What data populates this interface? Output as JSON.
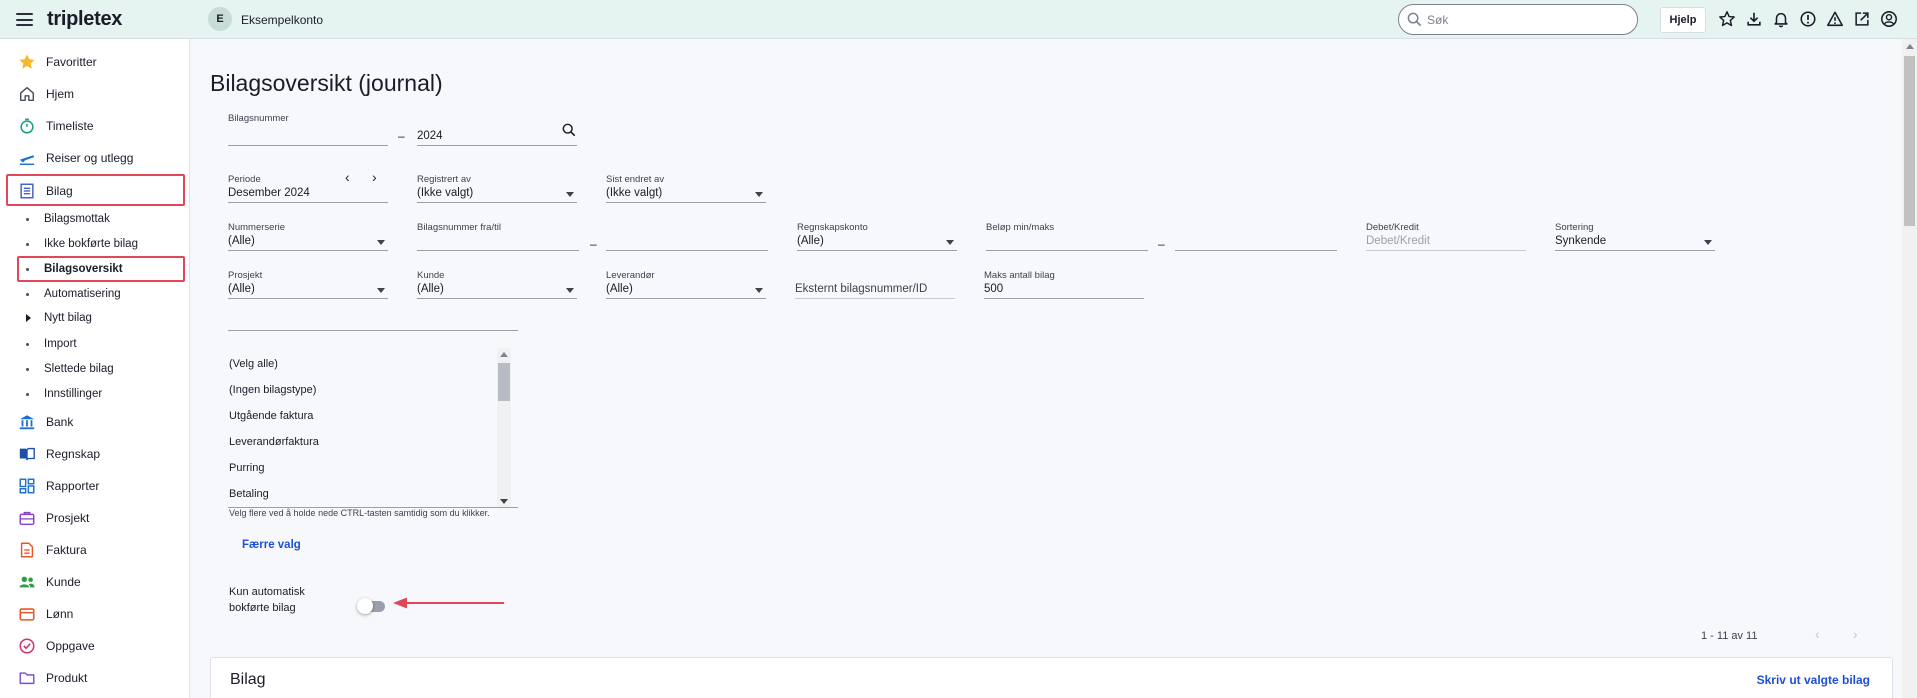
{
  "topbar": {
    "logo": "tripletex",
    "account_initial": "E",
    "account_name": "Eksempelkonto",
    "search_placeholder": "Søk",
    "help_label": "Hjelp",
    "icons": [
      "star-icon",
      "download-icon",
      "bell-icon",
      "alert-circle-icon",
      "warning-icon",
      "external-link-icon",
      "user-icon"
    ]
  },
  "sidebar": {
    "items": [
      {
        "label": "Favoritter",
        "icon": "star-icon"
      },
      {
        "label": "Hjem",
        "icon": "home-icon"
      },
      {
        "label": "Timeliste",
        "icon": "stopwatch-icon"
      },
      {
        "label": "Reiser og utlegg",
        "icon": "plane-icon"
      },
      {
        "label": "Bilag",
        "icon": "document-icon"
      },
      {
        "label": "Bank",
        "icon": "bank-icon"
      },
      {
        "label": "Regnskap",
        "icon": "book-icon"
      },
      {
        "label": "Rapporter",
        "icon": "dashboard-icon"
      },
      {
        "label": "Prosjekt",
        "icon": "briefcase-icon"
      },
      {
        "label": "Faktura",
        "icon": "invoice-icon"
      },
      {
        "label": "Kunde",
        "icon": "people-icon"
      },
      {
        "label": "Lønn",
        "icon": "wallet-icon"
      },
      {
        "label": "Oppgave",
        "icon": "check-circle-icon"
      },
      {
        "label": "Produkt",
        "icon": "folder-icon"
      }
    ],
    "bilag_sub": [
      {
        "label": "Bilagsmottak"
      },
      {
        "label": "Ikke bokførte bilag"
      },
      {
        "label": "Bilagsoversikt"
      },
      {
        "label": "Automatisering"
      },
      {
        "label": "Nytt bilag"
      },
      {
        "label": "Import"
      },
      {
        "label": "Slettede bilag"
      },
      {
        "label": "Innstillinger"
      }
    ],
    "highlight_color": "#e0485a"
  },
  "main": {
    "title": "Bilagsoversikt (journal)",
    "filters": {
      "bilagsnummer_label": "Bilagsnummer",
      "bilagsnummer_value": "",
      "year_value": "2024",
      "range_dash": "–",
      "periode_label": "Periode",
      "periode_value": "Desember 2024",
      "prev_arrow": "‹",
      "next_arrow": "›",
      "registrert_label": "Registrert av",
      "registrert_value": "(Ikke valgt)",
      "sist_endret_label": "Sist endret av",
      "sist_endret_value": "(Ikke valgt)",
      "nummerserie_label": "Nummerserie",
      "nummerserie_value": "(Alle)",
      "bilagsnr_fratil_label": "Bilagsnummer fra/til",
      "regnskapskonto_label": "Regnskapskonto",
      "regnskapskonto_value": "(Alle)",
      "belop_label": "Beløp min/maks",
      "debet_label": "Debet/Kredit",
      "debet_placeholder": "Debet/Kredit",
      "sortering_label": "Sortering",
      "sortering_value": "Synkende",
      "prosjekt_label": "Prosjekt",
      "prosjekt_value": "(Alle)",
      "kunde_label": "Kunde",
      "kunde_value": "(Alle)",
      "leverandor_label": "Leverandør",
      "leverandor_value": "(Alle)",
      "eksternt_placeholder": "Eksternt bilagsnummer/ID",
      "maks_label": "Maks antall bilag",
      "maks_value": "500"
    },
    "bilagstyper": [
      "(Velg alle)",
      "(Ingen bilagstype)",
      "Utgående faktura",
      "Leverandørfaktura",
      "Purring",
      "Betaling"
    ],
    "multi_hint": "Velg flere ved å holde nede CTRL-tasten samtidig som du klikker.",
    "fewer_label": "Færre valg",
    "toggle_label": "Kun automatisk bokførte bilag",
    "toggle_on": false,
    "pager_text": "1 - 11 av 11",
    "card_title": "Bilag",
    "card_action": "Skriv ut valgte bilag",
    "accent_color": "#1d4fd8"
  }
}
